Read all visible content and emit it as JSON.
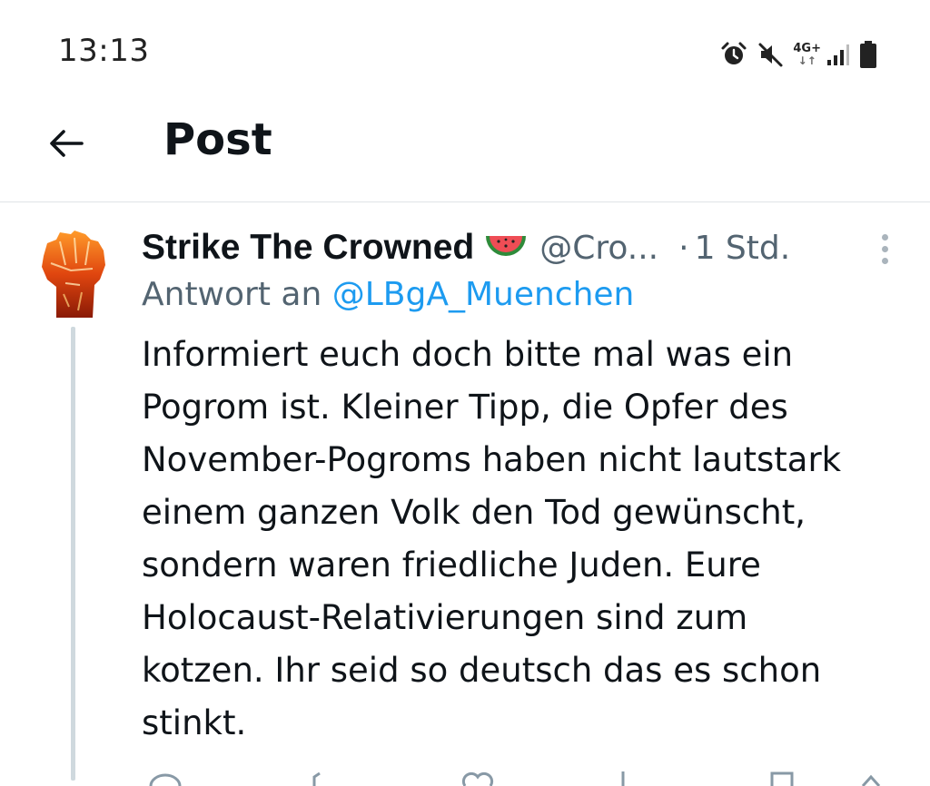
{
  "status_bar": {
    "time": "13:13",
    "network": "4G+",
    "icons": [
      "alarm-icon",
      "mute-icon",
      "network-4g-icon",
      "signal-icon",
      "battery-icon"
    ]
  },
  "header": {
    "title": "Post",
    "back_icon": "arrow-left-icon"
  },
  "post": {
    "display_name": "Strike The Crowned",
    "name_emoji": "watermelon-icon",
    "handle": "@Cro...",
    "separator": "·",
    "time": "1 Std.",
    "reply_prefix": "Antwort an",
    "reply_handle": "@LBgA_Muenchen",
    "body": "Informiert euch doch bitte mal was ein\nPogrom ist. Kleiner Tipp, die Opfer des\nNovember-Pogroms haben nicht lautstark\neinem ganzen Volk den Tod gewünscht,\nsondern waren friedliche Juden. Eure\nHolocaust-Relativierungen sind zum\nkotzen. Ihr seid so deutsch das es schon\nstinkt.",
    "avatar_icon": "raised-fist-icon"
  },
  "colors": {
    "text_primary": "#0f1419",
    "text_secondary": "#536471",
    "link": "#1d9bf0",
    "divider": "#dfe3e6",
    "thread_line": "#cfd9de"
  }
}
